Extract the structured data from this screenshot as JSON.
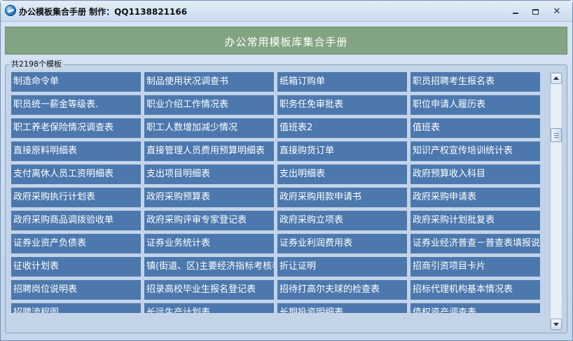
{
  "window": {
    "title": "办公模板集合手册 制作：QQ1138821166",
    "controls": {
      "minimize": "minimize-icon",
      "maximize": "maximize-icon",
      "close": "close-icon"
    }
  },
  "header": {
    "title": "办公常用模板库集合手册"
  },
  "group": {
    "label": "共2198个模板"
  },
  "templates": [
    "制造命令单",
    "制品使用状况调查书",
    "纸箱订购单",
    "职员招聘考生报名表",
    "职员统一薪金等级表.",
    "职业介绍工作情况表",
    "职务任免审批表",
    "职位申请人履历表",
    "职工养老保险情况调查表",
    "职工人数增加减少情况",
    "值班表2",
    "值班表",
    "直接原料明细表",
    "直接管理人员费用预算明细表",
    "直接购货订单",
    "知识产权宣传培训统计表",
    "支付离休人员工资明细表",
    "支出项目明细表",
    "支出明细表",
    "政府预算收入科目",
    "政府采购执行计划表",
    "政府采购预算表",
    "政府采购用款申请书",
    "政府采购申请表",
    "政府采购商品调拨验收单",
    "政府采购评审专家登记表",
    "政府采购立项表",
    "政府采购计划批复表",
    "证券业资产负债表",
    "证券业务统计表",
    "证券业利润费用表",
    "证券业经济普查－普查表填报说明",
    "征收计划表",
    "镇(街道、区)主要经济指标考核表",
    "折让证明",
    "招商引资项目卡片",
    "招聘岗位说明表",
    "招录高校毕业生报名登记表",
    "招待打高尔夫球的检查表",
    "招标代理机构基本情况表",
    "招聘流程图",
    "长远生产计划表",
    "长期投资明细表",
    "债权资产调查表"
  ],
  "scrollbar": {
    "position": 0.2
  }
}
